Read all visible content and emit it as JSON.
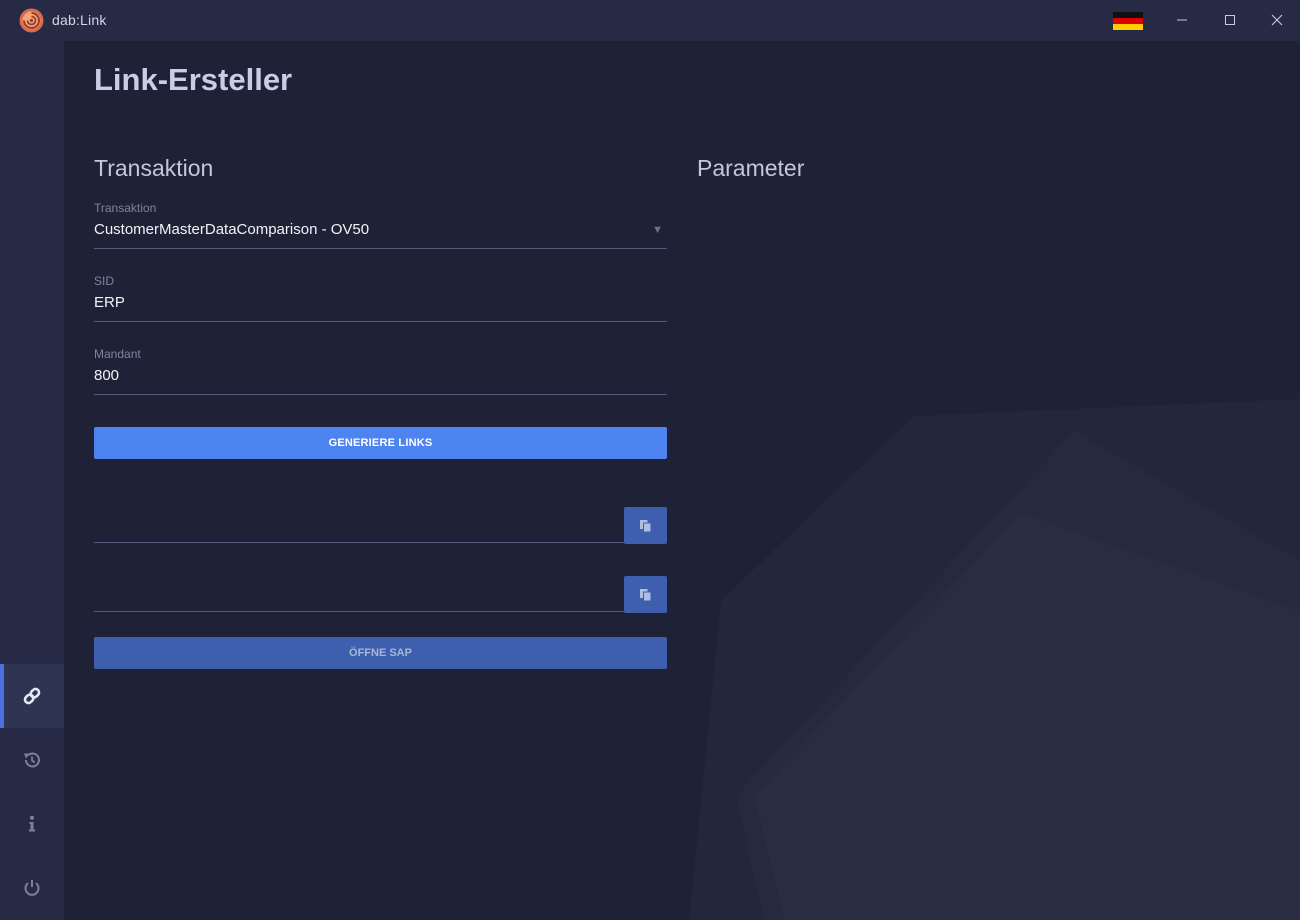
{
  "window": {
    "app_title": "dab:Link",
    "language_flag": "de-flag-icon",
    "controls": [
      "minimize-icon",
      "maximize-icon",
      "close-icon"
    ]
  },
  "sidebar": {
    "items": [
      {
        "name": "link",
        "icon": "link-icon",
        "active": true
      },
      {
        "name": "history",
        "icon": "history-icon",
        "active": false
      },
      {
        "name": "info",
        "icon": "info-icon",
        "active": false
      },
      {
        "name": "power",
        "icon": "power-icon",
        "active": false
      }
    ]
  },
  "main": {
    "page_title": "Link-Ersteller",
    "transaction_section": {
      "title": "Transaktion",
      "transaction": {
        "label": "Transaktion",
        "value": "CustomerMasterDataComparison - OV50"
      },
      "sid": {
        "label": "SID",
        "value": "ERP"
      },
      "mandant": {
        "label": "Mandant",
        "value": "800"
      },
      "generate_button": "GENERIERE LINKS",
      "link_fields": [
        {
          "value": "",
          "copy_icon": "copy-icon"
        },
        {
          "value": "",
          "copy_icon": "copy-icon"
        }
      ],
      "open_button": "ÖFFNE SAP"
    },
    "parameter_section": {
      "title": "Parameter"
    }
  },
  "colors": {
    "background": "#1f2236",
    "sidebar": "#262a44",
    "accent": "#4d84f0",
    "accent_dark": "#3d5fae",
    "active_indicator": "#4e6fe0"
  }
}
